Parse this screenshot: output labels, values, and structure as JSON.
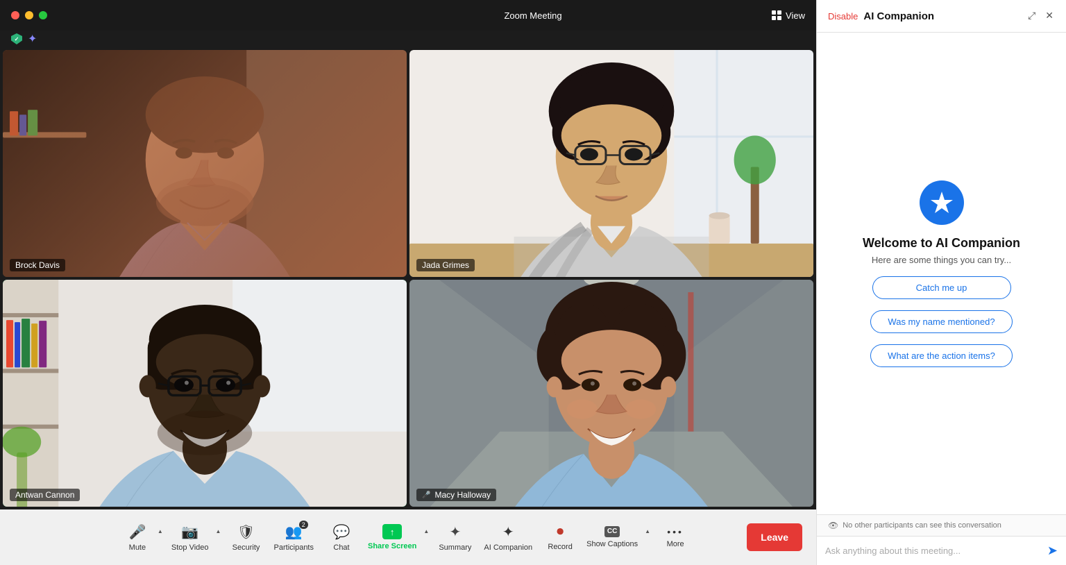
{
  "titleBar": {
    "title": "Zoom Meeting",
    "viewLabel": "View"
  },
  "statusIcons": {
    "shield": "✓",
    "sparkle": "✦"
  },
  "participants": [
    {
      "name": "Brock Davis",
      "id": "p1",
      "hasMic": false
    },
    {
      "name": "Jada Grimes",
      "id": "p2",
      "hasMic": false
    },
    {
      "name": "Antwan Cannon",
      "id": "p3",
      "hasMic": true,
      "activeSpeaker": true
    },
    {
      "name": "Macy Halloway",
      "id": "p4",
      "hasMic": true
    }
  ],
  "toolbar": {
    "mute": {
      "icon": "🎤",
      "label": "Mute"
    },
    "stopVideo": {
      "icon": "📹",
      "label": "Stop Video"
    },
    "security": {
      "icon": "🛡",
      "label": "Security"
    },
    "participants": {
      "icon": "👥",
      "label": "Participants",
      "count": "2"
    },
    "chat": {
      "icon": "💬",
      "label": "Chat"
    },
    "shareScreen": {
      "icon": "↑",
      "label": "Share Screen"
    },
    "summary": {
      "icon": "✦",
      "label": "Summary"
    },
    "aiCompanion": {
      "icon": "✦",
      "label": "AI Companion"
    },
    "record": {
      "icon": "⏺",
      "label": "Record"
    },
    "showCaptions": {
      "icon": "CC",
      "label": "Show Captions"
    },
    "more": {
      "icon": "•••",
      "label": "More"
    },
    "leave": "Leave"
  },
  "aiPanel": {
    "header": {
      "disableLabel": "Disable",
      "title": "AI Companion",
      "expandIcon": "⤢",
      "closeIcon": "✕"
    },
    "welcome": {
      "title": "Welcome to AI Companion",
      "subtitle": "Here are some things you can try...",
      "suggestions": [
        "Catch me up",
        "Was my name mentioned?",
        "What are the action items?"
      ]
    },
    "privacy": "No other participants can see this conversation",
    "input": {
      "placeholder": "Ask anything about this meeting..."
    }
  }
}
